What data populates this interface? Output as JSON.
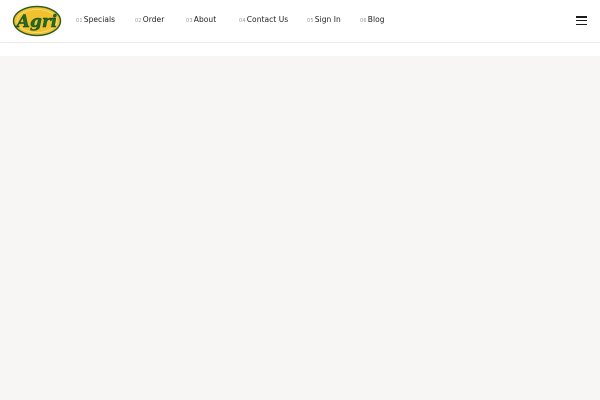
{
  "header": {
    "logo": {
      "text": "Agri",
      "icon": "agri-logo"
    },
    "nav": [
      {
        "num": "01",
        "label": "Specials"
      },
      {
        "num": "02",
        "label": "Order"
      },
      {
        "num": "03",
        "label": "About"
      },
      {
        "num": "04",
        "label": "Contact Us"
      },
      {
        "num": "05",
        "label": "Sign In"
      },
      {
        "num": "06",
        "label": "Blog"
      }
    ],
    "menu_icon": "hamburger-menu-icon"
  },
  "colors": {
    "header_bg": "#ffffff",
    "content_bg": "#f7f6f4",
    "logo_fill": "#f2c12e",
    "logo_text": "#1f6b2a"
  }
}
